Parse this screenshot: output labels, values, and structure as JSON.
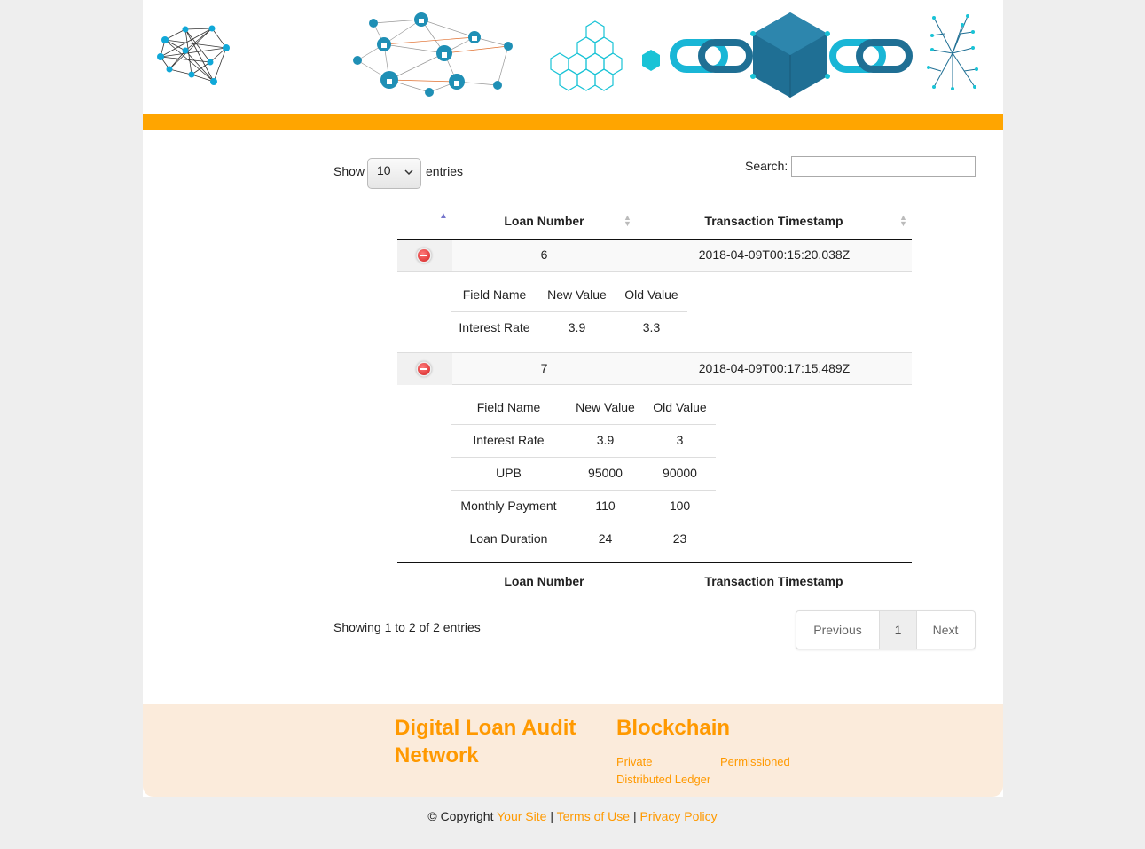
{
  "controls": {
    "show_label": "Show",
    "page_length": "10",
    "entries_label": "entries",
    "search_label": "Search:",
    "search_value": ""
  },
  "table": {
    "headers": [
      "Loan Number",
      "Transaction Timestamp"
    ],
    "rows": [
      {
        "loan_number": "6",
        "timestamp": "2018-04-09T00:15:20.038Z",
        "detail_headers": [
          "Field Name",
          "New Value",
          "Old Value"
        ],
        "details": [
          [
            "Interest Rate",
            "3.9",
            "3.3"
          ]
        ]
      },
      {
        "loan_number": "7",
        "timestamp": "2018-04-09T00:17:15.489Z",
        "detail_headers": [
          "Field Name",
          "New Value",
          "Old Value"
        ],
        "details": [
          [
            "Interest Rate",
            "3.9",
            "3"
          ],
          [
            "UPB",
            "95000",
            "90000"
          ],
          [
            "Monthly Payment",
            "110",
            "100"
          ],
          [
            "Loan Duration",
            "24",
            "23"
          ]
        ]
      }
    ],
    "footer_headers": [
      "Loan Number",
      "Transaction Timestamp"
    ]
  },
  "pagination": {
    "info": "Showing 1 to 2 of 2 entries",
    "previous": "Previous",
    "current_page": "1",
    "next": "Next"
  },
  "footer": {
    "brand_title": "Digital Loan Audit Network",
    "section_title": "Blockchain",
    "links": [
      "Private",
      "Permissioned",
      "Distributed Ledger"
    ]
  },
  "copyright": {
    "prefix": "© Copyright",
    "site_link": "Your Site",
    "terms_link": "Terms of Use",
    "privacy_link": "Privacy Policy",
    "separator": "|"
  },
  "colors": {
    "accent": "#ffa500",
    "link": "#ff9900",
    "footer_bg": "#fbebdb",
    "banner_blue": "#1f8fb5",
    "banner_teal": "#19c3d6"
  },
  "icons": [
    "network-graph-icon",
    "secure-network-icon",
    "blocks-icon",
    "chain-cube-icon",
    "branch-icon",
    "row-collapse-icon",
    "sort-icon",
    "chevron-down-icon"
  ]
}
